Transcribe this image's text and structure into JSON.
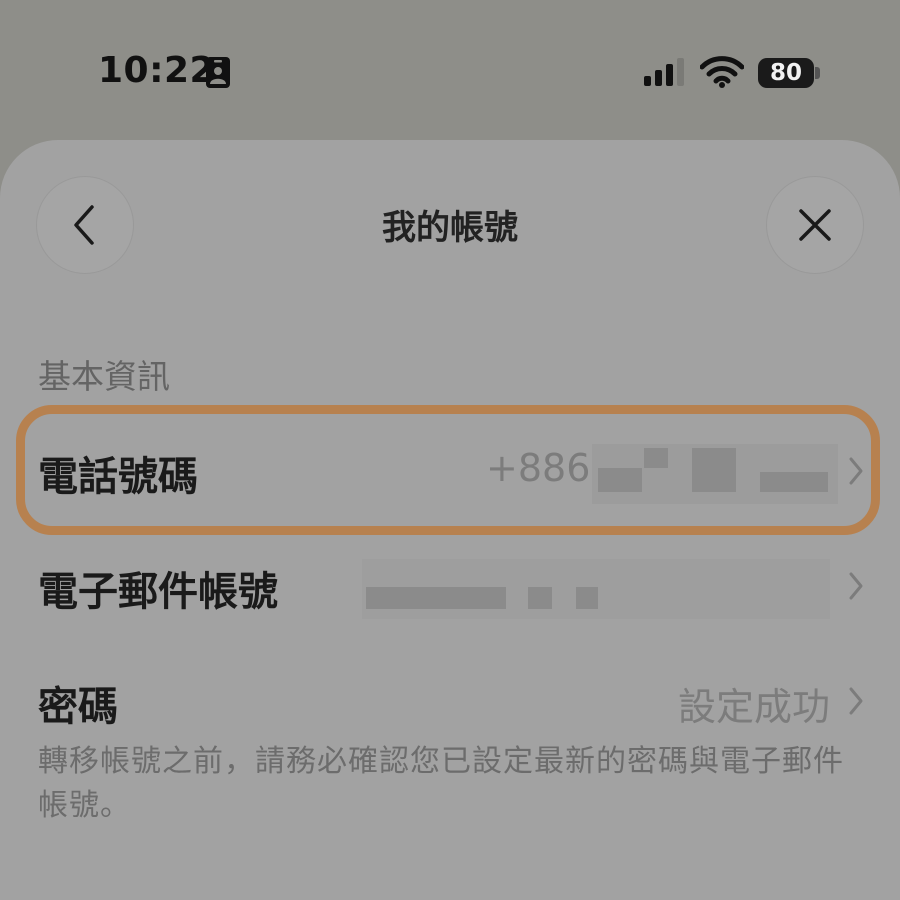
{
  "status_bar": {
    "time": "10:22",
    "battery_level": "80",
    "icons": [
      "id-card-icon",
      "cellular-signal-icon",
      "wifi-icon",
      "battery-icon"
    ]
  },
  "sheet": {
    "title": "我的帳號",
    "back_icon": "chevron-left-icon",
    "close_icon": "close-icon"
  },
  "section": {
    "header": "基本資訊"
  },
  "rows": {
    "phone": {
      "label": "電話號碼",
      "value_prefix": "+886"
    },
    "email": {
      "label": "電子郵件帳號"
    },
    "password": {
      "label": "密碼",
      "value": "設定成功"
    }
  },
  "footnote": "轉移帳號之前，請務必確認您已設定最新的密碼與電子郵件帳號。",
  "colors": {
    "highlight": "#b7814f",
    "overlay_background": "#8e8e89",
    "sheet_background": "#a2a2a2"
  }
}
